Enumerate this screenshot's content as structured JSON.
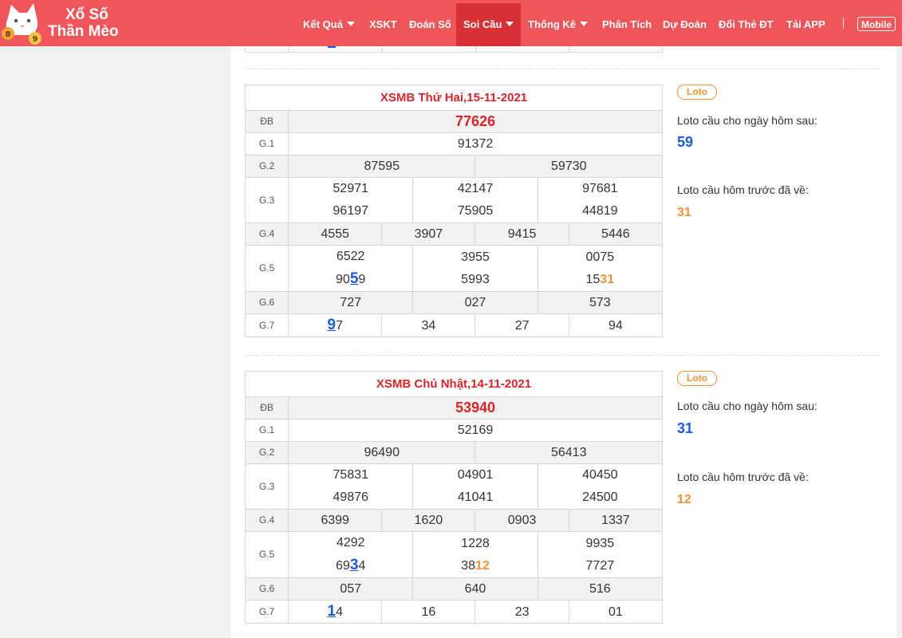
{
  "header": {
    "logo_line1": "Xổ Số",
    "logo_line2": "Thần Mèo",
    "nav": [
      {
        "label": "Kết Quả",
        "dropdown": true
      },
      {
        "label": "XSKT",
        "dropdown": false
      },
      {
        "label": "Đoán Số",
        "dropdown": false
      },
      {
        "label": "Soi Cầu",
        "dropdown": true,
        "active": true
      },
      {
        "label": "Thống Kê",
        "dropdown": true
      },
      {
        "label": "Phân Tích",
        "dropdown": false
      },
      {
        "label": "Dự Đoán",
        "dropdown": false
      },
      {
        "label": "Đổi Thẻ ĐT",
        "dropdown": false
      },
      {
        "label": "Tải APP",
        "dropdown": false
      }
    ],
    "mobile_label": "Mobile",
    "colors": {
      "bar": "#ee5659",
      "active": "#d73035"
    }
  },
  "results": [
    {
      "title": "XSMB Thứ Hai,15-11-2021",
      "labels": {
        "db": "ĐB",
        "g1": "G.1",
        "g2": "G.2",
        "g3": "G.3",
        "g4": "G.4",
        "g5": "G.5",
        "g6": "G.6",
        "g7": "G.7"
      },
      "db": "77626",
      "g1": "91372",
      "g2": [
        "87595",
        "59730"
      ],
      "g3": [
        "52971",
        "42147",
        "97681",
        "96197",
        "75905",
        "44819"
      ],
      "g4": [
        "4555",
        "3907",
        "9415",
        "5446"
      ],
      "g5": [
        "6522",
        "3955",
        "0075",
        "9059",
        "5993",
        "1531"
      ],
      "g6": [
        "727",
        "027",
        "573"
      ],
      "g7": [
        "97",
        "34",
        "27",
        "94"
      ],
      "g5_b1": {
        "pre": "90",
        "hl": "5",
        "post": "9"
      },
      "g5_c1": {
        "pre": "15",
        "hl": "31"
      },
      "g7_0": {
        "hl": "9",
        "post": "7"
      },
      "side": {
        "badge": "Loto",
        "next_label": "Loto cầu cho ngày hôm sau:",
        "next_value": "59",
        "prev_label": "Loto cầu hôm trước đã về:",
        "prev_value": "31"
      }
    },
    {
      "title": "XSMB Chủ Nhật,14-11-2021",
      "labels": {
        "db": "ĐB",
        "g1": "G.1",
        "g2": "G.2",
        "g3": "G.3",
        "g4": "G.4",
        "g5": "G.5",
        "g6": "G.6",
        "g7": "G.7"
      },
      "db": "53940",
      "g1": "52169",
      "g2": [
        "96490",
        "56413"
      ],
      "g3": [
        "75831",
        "04901",
        "40450",
        "49876",
        "41041",
        "24500"
      ],
      "g4": [
        "6399",
        "1620",
        "0903",
        "1337"
      ],
      "g5": [
        "4292",
        "1228",
        "9935",
        "6934",
        "3812",
        "7727"
      ],
      "g6": [
        "057",
        "640",
        "516"
      ],
      "g7": [
        "14",
        "16",
        "23",
        "01"
      ],
      "g5_b0": {
        "pre": "69",
        "hl": "3",
        "post": "4"
      },
      "g5_b1": {
        "pre": "38",
        "hl": "12"
      },
      "g7_0": {
        "hl": "1",
        "post": "4"
      },
      "side": {
        "badge": "Loto",
        "next_label": "Loto cầu cho ngày hôm sau:",
        "next_value": "31",
        "prev_label": "Loto cầu hôm trước đã về:",
        "prev_value": "12"
      }
    }
  ]
}
